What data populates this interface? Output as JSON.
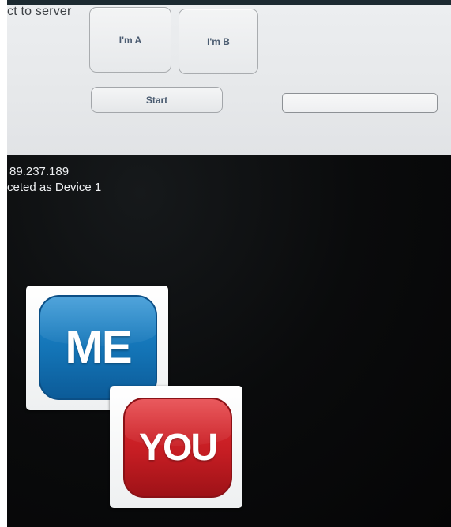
{
  "top_panel": {
    "connect_label": "ct to server",
    "button_a_label": "I'm A",
    "button_b_label": "I'm B",
    "start_label": "Start",
    "text_field": {
      "value": "",
      "placeholder": ""
    }
  },
  "status": {
    "ip_text": "89.237.189",
    "device_text": "ceted as Device 1"
  },
  "tiles": {
    "me_label": "ME",
    "you_label": "YOU"
  },
  "colors": {
    "me_blue": "#1373b5",
    "you_red": "#c51d23",
    "dark_background": "#0a0b0c",
    "panel_background": "#e6e8ea"
  }
}
